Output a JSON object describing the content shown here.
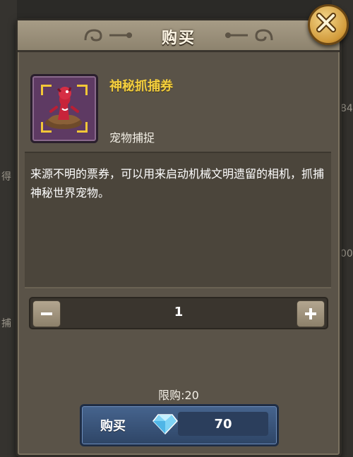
{
  "background": {
    "fragments": [
      "得",
      "捕",
      "84",
      "00"
    ]
  },
  "dialog": {
    "title": "购买",
    "close_icon": "close-x-icon"
  },
  "item": {
    "name": "神秘抓捕券",
    "type": "宠物捕捉",
    "icon": "capture-ticket-icon",
    "description": "来源不明的票券，可以用来启动机械文明遗留的相机，抓捕神秘世界宠物。"
  },
  "quantity": {
    "value": "1",
    "minus_icon": "minus-icon",
    "plus_icon": "plus-icon"
  },
  "purchase": {
    "limit_text": "限购:20",
    "buy_label": "购买",
    "currency_icon": "diamond-icon",
    "price": "70"
  },
  "colors": {
    "panel": "#5a5348",
    "title_gold": "#f4cf3e",
    "buy_button": "#3a5680",
    "item_frame": "#5e3a63"
  }
}
